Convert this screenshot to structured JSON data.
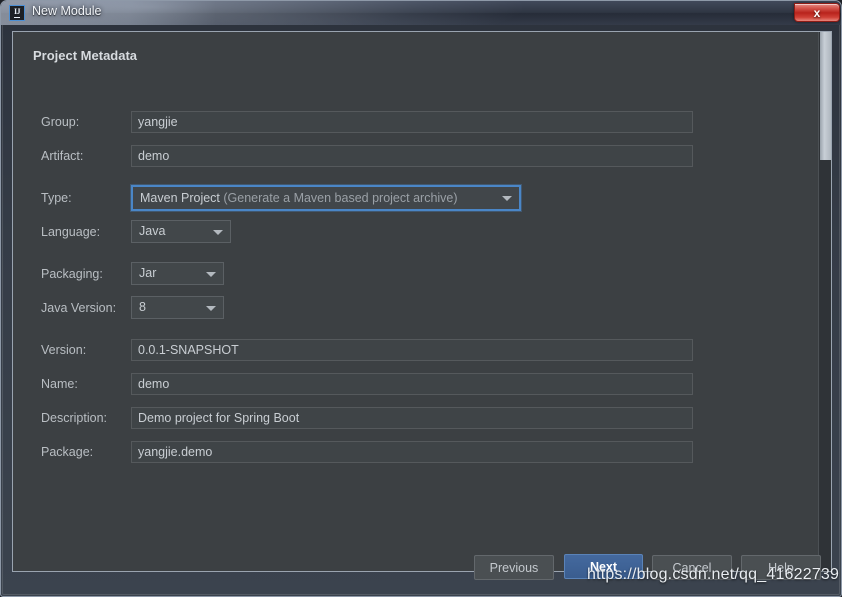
{
  "window": {
    "title": "New Module",
    "app_icon": "intellij-idea-icon",
    "close_label": "x",
    "accent_color": "#4a86c7",
    "panel_background": "#3c4043",
    "titlebar_background": "#2f3643",
    "close_button_color": "#b8231c"
  },
  "form": {
    "section_title": "Project Metadata",
    "fields": [
      {
        "name": "group",
        "label": "Group:",
        "value": "yangjie",
        "control": "text"
      },
      {
        "name": "artifact",
        "label": "Artifact:",
        "value": "demo",
        "control": "text"
      },
      {
        "name": "type",
        "label": "Type:",
        "value": "Maven Project",
        "value_hint": "(Generate a Maven based project archive)",
        "control": "combo",
        "focused": true
      },
      {
        "name": "language",
        "label": "Language:",
        "value": "Java",
        "control": "combo"
      },
      {
        "name": "packaging",
        "label": "Packaging:",
        "value": "Jar",
        "control": "combo"
      },
      {
        "name": "java-version",
        "label": "Java Version:",
        "value": "8",
        "control": "combo"
      },
      {
        "name": "version",
        "label": "Version:",
        "value": "0.0.1-SNAPSHOT",
        "control": "text"
      },
      {
        "name": "name",
        "label": "Name:",
        "value": "demo",
        "control": "text"
      },
      {
        "name": "description",
        "label": "Description:",
        "value": "Demo project for Spring Boot",
        "control": "text"
      },
      {
        "name": "package",
        "label": "Package:",
        "value": "yangjie.demo",
        "control": "text"
      }
    ]
  },
  "footer": {
    "buttons": [
      {
        "name": "previous",
        "label": "Previous",
        "primary": false
      },
      {
        "name": "next",
        "label": "Next",
        "primary": true
      },
      {
        "name": "cancel",
        "label": "Cancel",
        "primary": false
      },
      {
        "name": "help",
        "label": "Help",
        "primary": false
      }
    ]
  },
  "overlay": {
    "watermark": "https://blog.csdn.net/qq_41622739"
  }
}
